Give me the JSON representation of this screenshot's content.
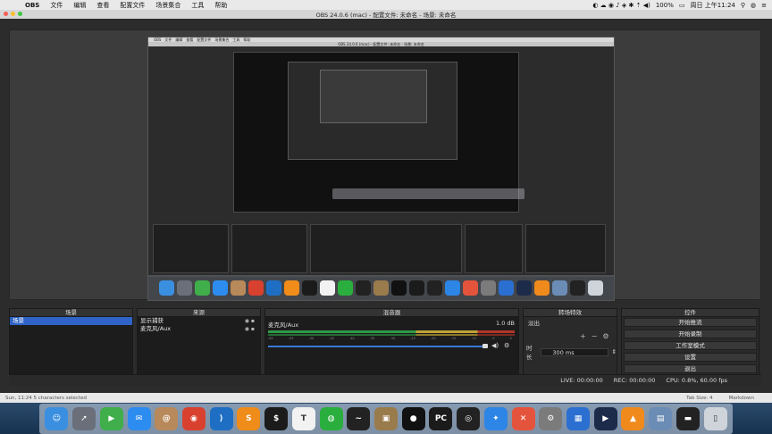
{
  "menubar": {
    "app": "OBS",
    "items": [
      "文件",
      "编辑",
      "查看",
      "配置文件",
      "场景集合",
      "工具",
      "帮助"
    ],
    "battery": "100%",
    "datetime": "周日 上午11:24"
  },
  "window": {
    "title": "OBS 24.0.6 (mac) - 配置文件: 未命名 - 场景: 未命名"
  },
  "nested": {
    "menu": [
      "OBS",
      "文件",
      "编辑",
      "查看",
      "配置文件",
      "场景集合",
      "工具",
      "帮助"
    ],
    "title": "OBS 24.0.6 (mac) - 配置文件: 未命名 - 场景: 未命名"
  },
  "panels": {
    "scenes": {
      "title": "场景",
      "items": [
        "场景"
      ]
    },
    "sources": {
      "title": "来源",
      "items": [
        "显示捕获",
        "麦克风/Aux"
      ]
    },
    "mixer": {
      "title": "混音器",
      "channel": "麦克风/Aux",
      "level": "1.0 dB",
      "ticks": [
        "-60",
        "-55",
        "-50",
        "-45",
        "-40",
        "-35",
        "-30",
        "-25",
        "-20",
        "-15",
        "-10",
        "-5",
        "0"
      ]
    },
    "transitions": {
      "title": "转场特效",
      "selected": "淡出",
      "duration_label": "时长",
      "duration_value": "300 ms"
    },
    "controls": {
      "title": "控件",
      "buttons": [
        "开始推流",
        "开始录制",
        "工作室模式",
        "设置",
        "退出"
      ]
    }
  },
  "status": {
    "live": "LIVE: 00:00:00",
    "rec": "REC: 00:00:00",
    "cpu": "CPU: 0.8%, 60.00 fps"
  },
  "editor": {
    "left": "Sun, 11:24   5 characters selected",
    "tab_size": "Tab Size: 4",
    "mode": "Markdown"
  },
  "dock": {
    "apps": [
      {
        "name": "finder",
        "color": "#3b8fe0",
        "glyph": "☺"
      },
      {
        "name": "launchpad",
        "color": "#6a6f79",
        "glyph": "➚"
      },
      {
        "name": "facetime",
        "color": "#3fae4b",
        "glyph": "▶"
      },
      {
        "name": "messages",
        "color": "#2d8cf0",
        "glyph": "✉"
      },
      {
        "name": "contacts",
        "color": "#b8895a",
        "glyph": "@"
      },
      {
        "name": "chrome",
        "color": "#d9412f",
        "glyph": "◉"
      },
      {
        "name": "vscode",
        "color": "#1e6fc4",
        "glyph": "⟩"
      },
      {
        "name": "sublime",
        "color": "#ef8c1a",
        "glyph": "S"
      },
      {
        "name": "terminal",
        "color": "#1b1b1b",
        "glyph": "$"
      },
      {
        "name": "typora",
        "color": "#f2f2f2",
        "glyph": "T"
      },
      {
        "name": "wechat",
        "color": "#2aae3e",
        "glyph": "◍"
      },
      {
        "name": "activity",
        "color": "#222",
        "glyph": "~"
      },
      {
        "name": "archiver",
        "color": "#9a7b4c",
        "glyph": "▣"
      },
      {
        "name": "qq",
        "color": "#111",
        "glyph": "●"
      },
      {
        "name": "pycharm",
        "color": "#1b1b1b",
        "glyph": "PC"
      },
      {
        "name": "obs",
        "color": "#222",
        "glyph": "◎"
      },
      {
        "name": "safari",
        "color": "#2d85e5",
        "glyph": "✦"
      },
      {
        "name": "xmind",
        "color": "#e4543d",
        "glyph": "✕"
      },
      {
        "name": "prefs",
        "color": "#7b7b7b",
        "glyph": "⚙"
      },
      {
        "name": "vmware",
        "color": "#2b6fd1",
        "glyph": "▦"
      },
      {
        "name": "quicktime",
        "color": "#1c2b4a",
        "glyph": "▶"
      },
      {
        "name": "vlc",
        "color": "#f08a1c",
        "glyph": "▲"
      },
      {
        "name": "preview",
        "color": "#6b8cb5",
        "glyph": "▤"
      },
      {
        "name": "screen",
        "color": "#222",
        "glyph": "▬"
      },
      {
        "name": "trash",
        "color": "#cfd4db",
        "glyph": "▯"
      }
    ]
  }
}
